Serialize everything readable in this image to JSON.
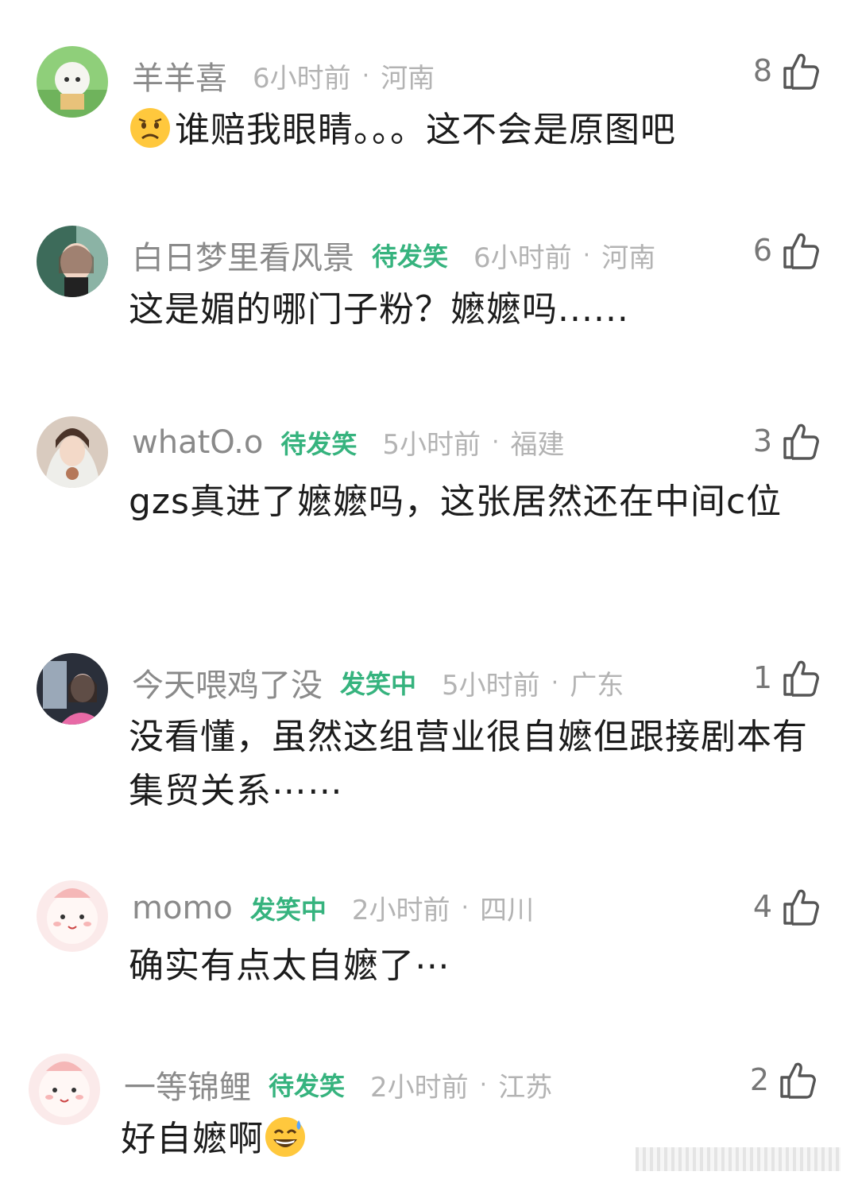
{
  "comments": [
    {
      "username": "羊羊喜",
      "tag": "",
      "time": "6小时前",
      "location": "河南",
      "likes": "8",
      "text": "谁赔我眼睛。。。这不会是原图吧",
      "emoji": "worried-face"
    },
    {
      "username": "白日梦里看风景",
      "tag": "待发笑",
      "time": "6小时前",
      "location": "河南",
      "likes": "6",
      "text": "这是媚的哪门子粉？嬷嬷吗......"
    },
    {
      "username": "whatO.o",
      "tag": "待发笑",
      "time": "5小时前",
      "location": "福建",
      "likes": "3",
      "text": "gzs真进了嬷嬷吗，这张居然还在中间c位"
    },
    {
      "username": "今天喂鸡了没",
      "tag": "发笑中",
      "time": "5小时前",
      "location": "广东",
      "likes": "1",
      "text": "没看懂，虽然这组营业很自嬷但跟接剧本有集贸关系⋯⋯"
    },
    {
      "username": "momo",
      "tag": "发笑中",
      "time": "2小时前",
      "location": "四川",
      "likes": "4",
      "text": "确实有点太自嬷了⋯"
    },
    {
      "username": "一等锦鲤",
      "tag": "待发笑",
      "time": "2小时前",
      "location": "江苏",
      "likes": "2",
      "text": "好自嬷啊",
      "emoji_after": "grinning-sweat-face"
    }
  ],
  "dot": "·",
  "colors": {
    "tag": "#36b37e",
    "username": "#8a8a8a",
    "meta": "#b3b3b3",
    "text": "#1c1c1c"
  }
}
